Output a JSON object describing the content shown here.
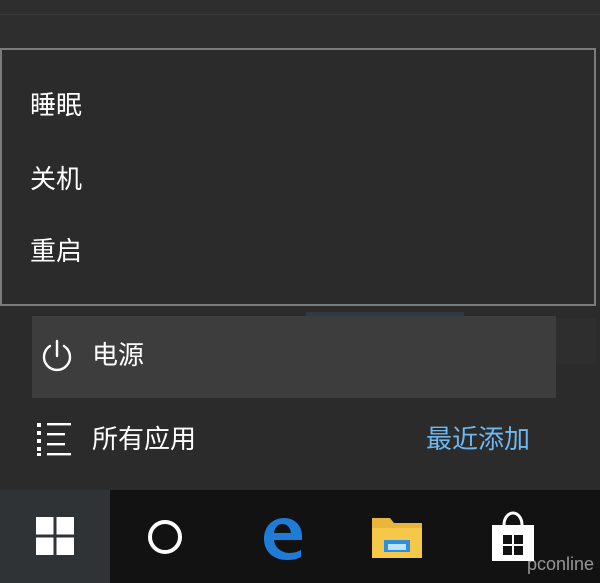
{
  "power_menu": {
    "items": [
      {
        "label": "睡眠"
      },
      {
        "label": "关机"
      },
      {
        "label": "重启"
      }
    ]
  },
  "power_row": {
    "label": "电源",
    "icon": "power-icon"
  },
  "apps_row": {
    "label": "所有应用",
    "icon": "all-apps-list-icon"
  },
  "recent": {
    "label": "最近添加"
  },
  "taskbar": {
    "items": [
      {
        "name": "start",
        "icon": "windows-logo-icon"
      },
      {
        "name": "cortana",
        "icon": "cortana-ring-icon"
      },
      {
        "name": "edge",
        "icon": "edge-icon"
      },
      {
        "name": "file-explorer",
        "icon": "folder-icon"
      },
      {
        "name": "store",
        "icon": "store-bag-icon"
      }
    ]
  },
  "colors": {
    "menu_bg": "#2b2b2b",
    "menu_border": "#7a7a7a",
    "highlight": "#3d3d3d",
    "link": "#6fb7ee",
    "taskbar": "#121212",
    "edge_blue": "#1e7bd8",
    "folder_yellow": "#f6c84a"
  }
}
